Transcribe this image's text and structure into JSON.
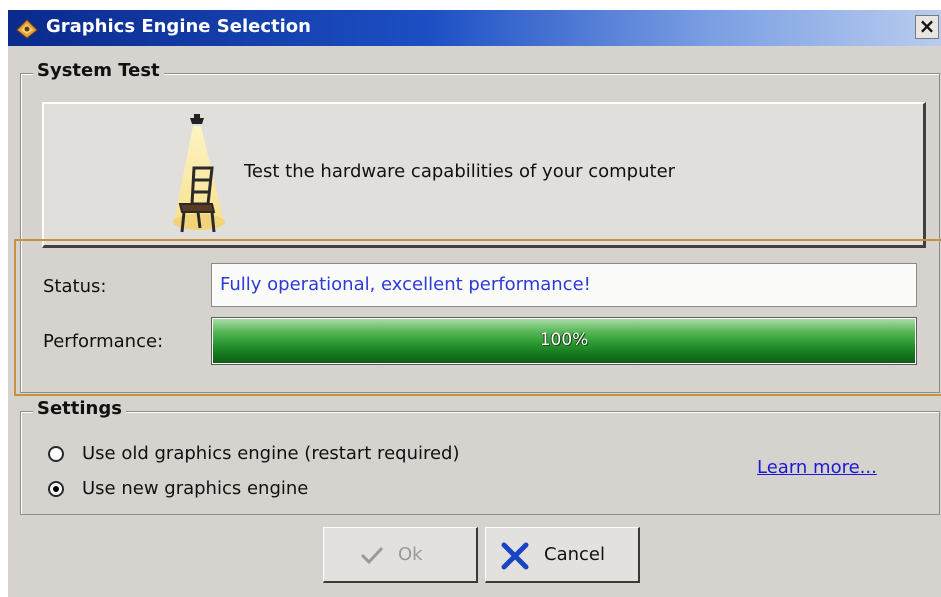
{
  "window": {
    "title": "Graphics Engine Selection",
    "close_label": "×"
  },
  "system_test": {
    "legend": "System Test",
    "test_button_label": "Test the hardware capabilities of your computer",
    "status_label": "Status:",
    "status_value": "Fully operational, excellent performance!",
    "performance_label": "Performance:",
    "performance_value": 1.0,
    "performance_text": "100%"
  },
  "settings": {
    "legend": "Settings",
    "options": [
      {
        "label": "Use old graphics engine (restart required)",
        "selected": false
      },
      {
        "label": "Use new graphics engine",
        "selected": true
      }
    ],
    "learn_more": "Learn more..."
  },
  "buttons": {
    "ok_label": "Ok",
    "cancel_label": "Cancel"
  },
  "colors": {
    "status_text": "#2b3bd6",
    "progress_fill": "#2a9a32",
    "highlight_border": "#c8913e",
    "link": "#1a1ad6"
  },
  "icons": {
    "title": "graphics-engine-icon",
    "test": "spotlight-chair-icon",
    "ok": "checkmark-icon",
    "cancel": "x-icon"
  }
}
